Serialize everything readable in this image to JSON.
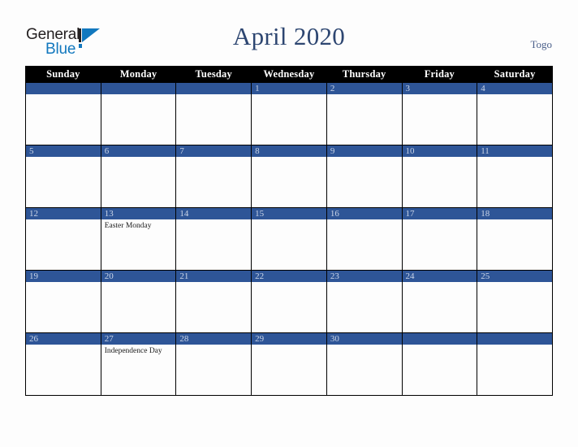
{
  "branding": {
    "line1": "General",
    "line2": "Blue",
    "mark_icon": "triangle-logo-icon",
    "accent_blue": "#1278be",
    "text_black": "#231f20"
  },
  "header": {
    "title": "April 2020",
    "locale": "Togo",
    "title_color": "#2d4671",
    "locale_color": "#4a5f8a"
  },
  "calendar": {
    "columns": [
      "Sunday",
      "Monday",
      "Tuesday",
      "Wednesday",
      "Thursday",
      "Friday",
      "Saturday"
    ],
    "header_bg": "#000000",
    "header_fg": "#ffffff",
    "daynum_bg": "#2e5597",
    "daynum_fg": "#ccd6e8",
    "cell_bg": "#fdfdfd",
    "border_color": "#000000",
    "weeks": [
      [
        {
          "day": "",
          "event": ""
        },
        {
          "day": "",
          "event": ""
        },
        {
          "day": "",
          "event": ""
        },
        {
          "day": "1",
          "event": ""
        },
        {
          "day": "2",
          "event": ""
        },
        {
          "day": "3",
          "event": ""
        },
        {
          "day": "4",
          "event": ""
        }
      ],
      [
        {
          "day": "5",
          "event": ""
        },
        {
          "day": "6",
          "event": ""
        },
        {
          "day": "7",
          "event": ""
        },
        {
          "day": "8",
          "event": ""
        },
        {
          "day": "9",
          "event": ""
        },
        {
          "day": "10",
          "event": ""
        },
        {
          "day": "11",
          "event": ""
        }
      ],
      [
        {
          "day": "12",
          "event": ""
        },
        {
          "day": "13",
          "event": "Easter Monday"
        },
        {
          "day": "14",
          "event": ""
        },
        {
          "day": "15",
          "event": ""
        },
        {
          "day": "16",
          "event": ""
        },
        {
          "day": "17",
          "event": ""
        },
        {
          "day": "18",
          "event": ""
        }
      ],
      [
        {
          "day": "19",
          "event": ""
        },
        {
          "day": "20",
          "event": ""
        },
        {
          "day": "21",
          "event": ""
        },
        {
          "day": "22",
          "event": ""
        },
        {
          "day": "23",
          "event": ""
        },
        {
          "day": "24",
          "event": ""
        },
        {
          "day": "25",
          "event": ""
        }
      ],
      [
        {
          "day": "26",
          "event": ""
        },
        {
          "day": "27",
          "event": "Independence Day"
        },
        {
          "day": "28",
          "event": ""
        },
        {
          "day": "29",
          "event": ""
        },
        {
          "day": "30",
          "event": ""
        },
        {
          "day": "",
          "event": ""
        },
        {
          "day": "",
          "event": ""
        }
      ]
    ]
  }
}
